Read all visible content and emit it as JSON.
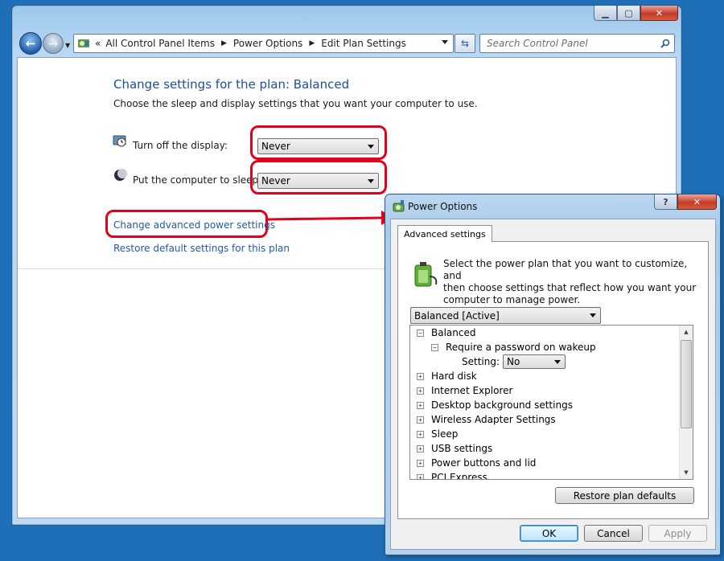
{
  "main_window": {
    "breadcrumb": [
      "All Control Panel Items",
      "Power Options",
      "Edit Plan Settings"
    ],
    "breadcrumb_overflow": "«",
    "search_placeholder": "Search Control Panel",
    "page_title": "Change settings for the plan: Balanced",
    "page_subtitle": "Choose the sleep and display settings that you want your computer to use.",
    "settings": [
      {
        "label": "Turn off the display:",
        "value": "Never",
        "icon": "display-timer-icon"
      },
      {
        "label": "Put the computer to sleep:",
        "value": "Never",
        "icon": "sleep-moon-icon"
      }
    ],
    "links": {
      "advanced": "Change advanced power settings",
      "restore": "Restore default settings for this plan"
    }
  },
  "dialog": {
    "title": "Power Options",
    "tab": "Advanced settings",
    "description": [
      "Select the power plan that you want to customize, and",
      "then choose settings that reflect how you want your",
      "computer to manage power."
    ],
    "plan_select": "Balanced [Active]",
    "tree": [
      {
        "label": "Balanced",
        "toggle": "−",
        "level": 0
      },
      {
        "label": "Require a password on wakeup",
        "toggle": "−",
        "level": 1
      },
      {
        "label": "Setting:",
        "value": "No",
        "level": 2
      },
      {
        "label": "Hard disk",
        "toggle": "+",
        "level": 0
      },
      {
        "label": "Internet Explorer",
        "toggle": "+",
        "level": 0
      },
      {
        "label": "Desktop background settings",
        "toggle": "+",
        "level": 0
      },
      {
        "label": "Wireless Adapter Settings",
        "toggle": "+",
        "level": 0
      },
      {
        "label": "Sleep",
        "toggle": "+",
        "level": 0
      },
      {
        "label": "USB settings",
        "toggle": "+",
        "level": 0
      },
      {
        "label": "Power buttons and lid",
        "toggle": "+",
        "level": 0
      },
      {
        "label": "PCI Express",
        "toggle": "+",
        "level": 0
      }
    ],
    "restore_button": "Restore plan defaults",
    "buttons": {
      "ok": "OK",
      "cancel": "Cancel",
      "apply": "Apply"
    }
  },
  "colors": {
    "highlight": "#e3001b",
    "link": "#1f5aa5",
    "title": "#1f4e98"
  }
}
